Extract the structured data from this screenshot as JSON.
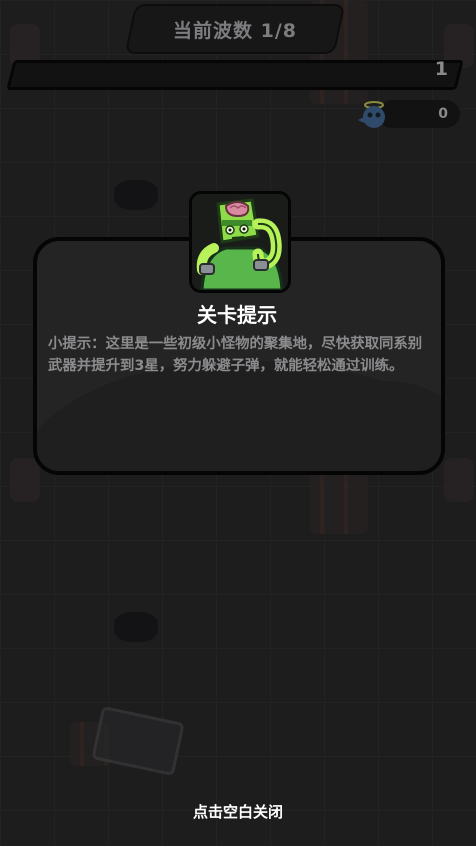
{
  "header": {
    "wave_label": "当前波数 1/8",
    "level": "1",
    "wave_progress": 0.0
  },
  "currency": {
    "count": "0",
    "icon": "gem-creature-icon"
  },
  "modal": {
    "title": "关卡提示",
    "body": "小提示：这里是一些初级小怪物的聚集地，尽快获取同系别武器并提升到3星，努力躲避子弹，就能轻松通过训练。",
    "portrait_icon": "green-zombie-monster-icon"
  },
  "footer": {
    "close_hint": "点击空白关闭"
  },
  "colors": {
    "overlay": "#1b1b1c",
    "modal_bg": "#242425",
    "text_primary": "#ffffff",
    "text_secondary": "#8c8c8e",
    "monster_green": "#7fd13b"
  }
}
